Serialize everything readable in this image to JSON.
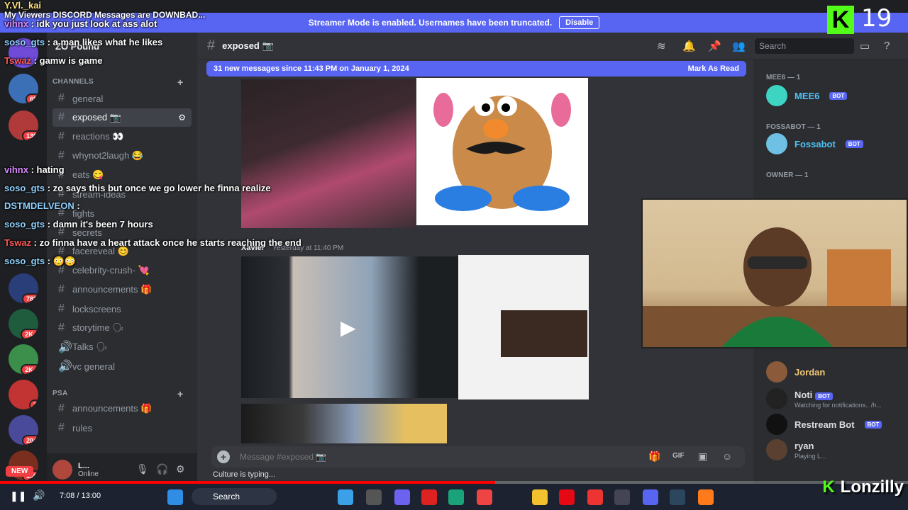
{
  "streamer_bar": {
    "message": "Streamer Mode is enabled. Usernames have been truncated.",
    "disable_label": "Disable"
  },
  "overlay_title": "My Viewers DISCORD Messages are DOWNBAD...",
  "cam_count": "19",
  "server": {
    "name": "ZO Pound"
  },
  "sidebar": {
    "channels_cat": "CHANNELS",
    "channels": [
      "general",
      "exposed 📷",
      "reactions 👀",
      "whynot2laugh 😂",
      "eats 😋",
      "stream-ideas",
      "fights",
      "secrets",
      "facereveal 😊",
      "celebrity-crush- 💘",
      "announcements 🎁",
      "lockscreens",
      "storytime 🗣",
      "Talks 🗣",
      "vc general"
    ],
    "psa_cat": "PSA",
    "psa_channels": [
      "announcements 🎁",
      "rules"
    ]
  },
  "user_panel": {
    "name": "L...",
    "status": "Online"
  },
  "chat": {
    "channel": "exposed 📷",
    "new_messages": "31 new messages since 11:43 PM on January 1, 2024",
    "mark_read": "Mark As Read",
    "search": "Search",
    "author": "Xavier",
    "timestamp": "Yesterday at 11:40 PM",
    "placeholder": "Message #exposed 📷",
    "typing": "Culture is typing..."
  },
  "members": {
    "mee6_cat": "MEE6 — 1",
    "mee6": "MEE6",
    "fossabot_cat": "FOSSABOT — 1",
    "fossabot": "Fossabot",
    "owner_cat": "OWNER — 1",
    "bot_tag": "BOT",
    "jordan": "Jordan",
    "noti": "Noti",
    "noti_sub": "Watching for notifications.. /h...",
    "restream": "Restream Bot",
    "ryan": "ryan",
    "ryan_sub": "Playing L..."
  },
  "stream_chat": [
    {
      "user": "Y.Vl._kai",
      "msg": "",
      "cls": "yel"
    },
    {
      "user": "vihnx",
      "msg": "idk you just look at ass alot",
      "cls": "pur"
    },
    {
      "user": "soso_gts",
      "msg": "a man likes what he likes",
      "cls": ""
    },
    {
      "user": "Tswaz",
      "msg": "gamw is game",
      "cls": "red"
    },
    {
      "user": "vihnx",
      "msg": "hating",
      "cls": "pur"
    },
    {
      "user": "soso_gts",
      "msg": "zo says this but once we go lower he finna realize",
      "cls": ""
    },
    {
      "user": "DSTMDELVEON",
      "msg": "",
      "cls": ""
    },
    {
      "user": "soso_gts",
      "msg": "damn it's been 7 hours",
      "cls": ""
    },
    {
      "user": "Tswaz",
      "msg": "zo finna have a heart attack once he starts reaching the end",
      "cls": "red"
    },
    {
      "user": "soso_gts",
      "msg": "😳😳",
      "cls": ""
    }
  ],
  "player": {
    "time": "7:08 / 13:00",
    "progress": 0.545
  },
  "taskbar": {
    "search": "Search"
  },
  "brand": "Lonzilly",
  "server_badges": [
    "65",
    "130",
    "782",
    "2K+",
    "2K+",
    "7",
    "204",
    "130"
  ],
  "new_badge": "NEW",
  "colors": {
    "blurple": "#5865f2",
    "bg": "#313338",
    "sidebar": "#2b2d31",
    "rail": "#1e1f22",
    "kick": "#53fc18"
  }
}
